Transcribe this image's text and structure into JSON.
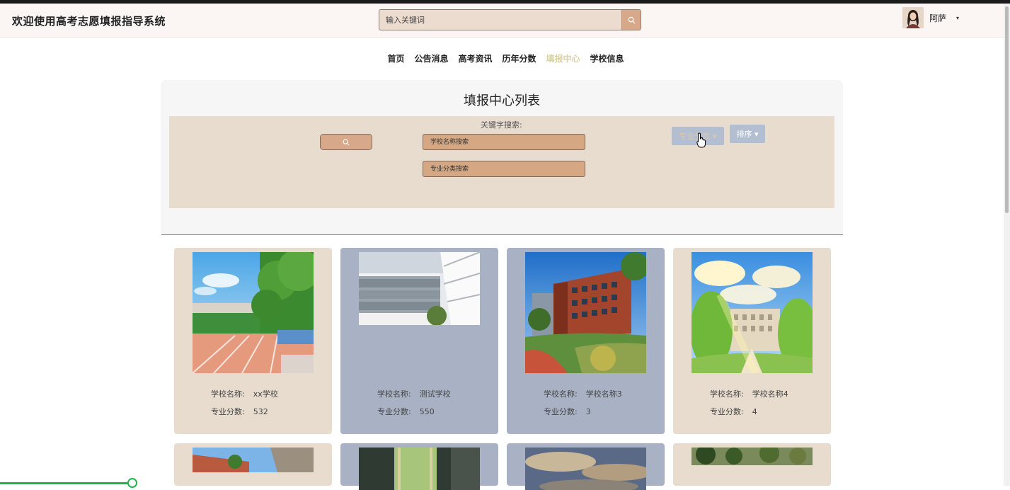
{
  "header": {
    "title": "欢迎使用高考志愿填报指导系统",
    "search_placeholder": "输入关键词",
    "search_icon": "search-icon",
    "username": "阿萨",
    "user_caret": "▾"
  },
  "nav": {
    "items": [
      "首页",
      "公告消息",
      "高考资讯",
      "历年分数",
      "填报中心",
      "学校信息"
    ],
    "active_index": 4
  },
  "panel": {
    "title": "填报中心列表",
    "keyword_label": "关键字搜索:",
    "school_placeholder": "学校名称搜索",
    "major_placeholder": "专业分类搜索",
    "sort_major_label": "专业分数 ▾",
    "sort_label": "排序 ▾"
  },
  "card_labels": {
    "name_key": "学校名称:",
    "score_key": "专业分数:"
  },
  "cards": [
    {
      "name": "xx学校",
      "score": "532",
      "image": "campus-track-image",
      "color": "#e8dccf"
    },
    {
      "name": "测试学校",
      "score": "550",
      "image": "modern-building-image",
      "color": "#a9b2c4"
    },
    {
      "name": "学校名称3",
      "score": "3",
      "image": "red-brick-building-image",
      "color": "#a9b2c4"
    },
    {
      "name": "学校名称4",
      "score": "4",
      "image": "anime-school-image",
      "color": "#e8dccf"
    }
  ],
  "colors": {
    "accent": "#d7a88a",
    "nav_active": "#d9d3a2",
    "card_beige": "#e8dccf",
    "card_blue": "#a9b2c4",
    "sort_button": "#b3bfd1"
  }
}
